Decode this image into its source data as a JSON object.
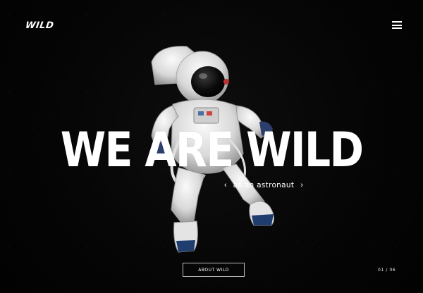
{
  "header": {
    "logo_text": "WILD",
    "menu_icon": "hamburger-icon"
  },
  "hero": {
    "headline": "WE ARE WILD",
    "subtitle": "as an astronaut",
    "prev_icon": "chevron-left-icon",
    "next_icon": "chevron-right-icon",
    "prev_glyph": "‹",
    "next_glyph": "›"
  },
  "footer": {
    "about_label": "ABOUT WILD",
    "pager": "01 / 06"
  },
  "colors": {
    "background": "#050505",
    "text": "#ffffff",
    "suit": "#e9e9e9",
    "boots": "#1f3d6e"
  }
}
